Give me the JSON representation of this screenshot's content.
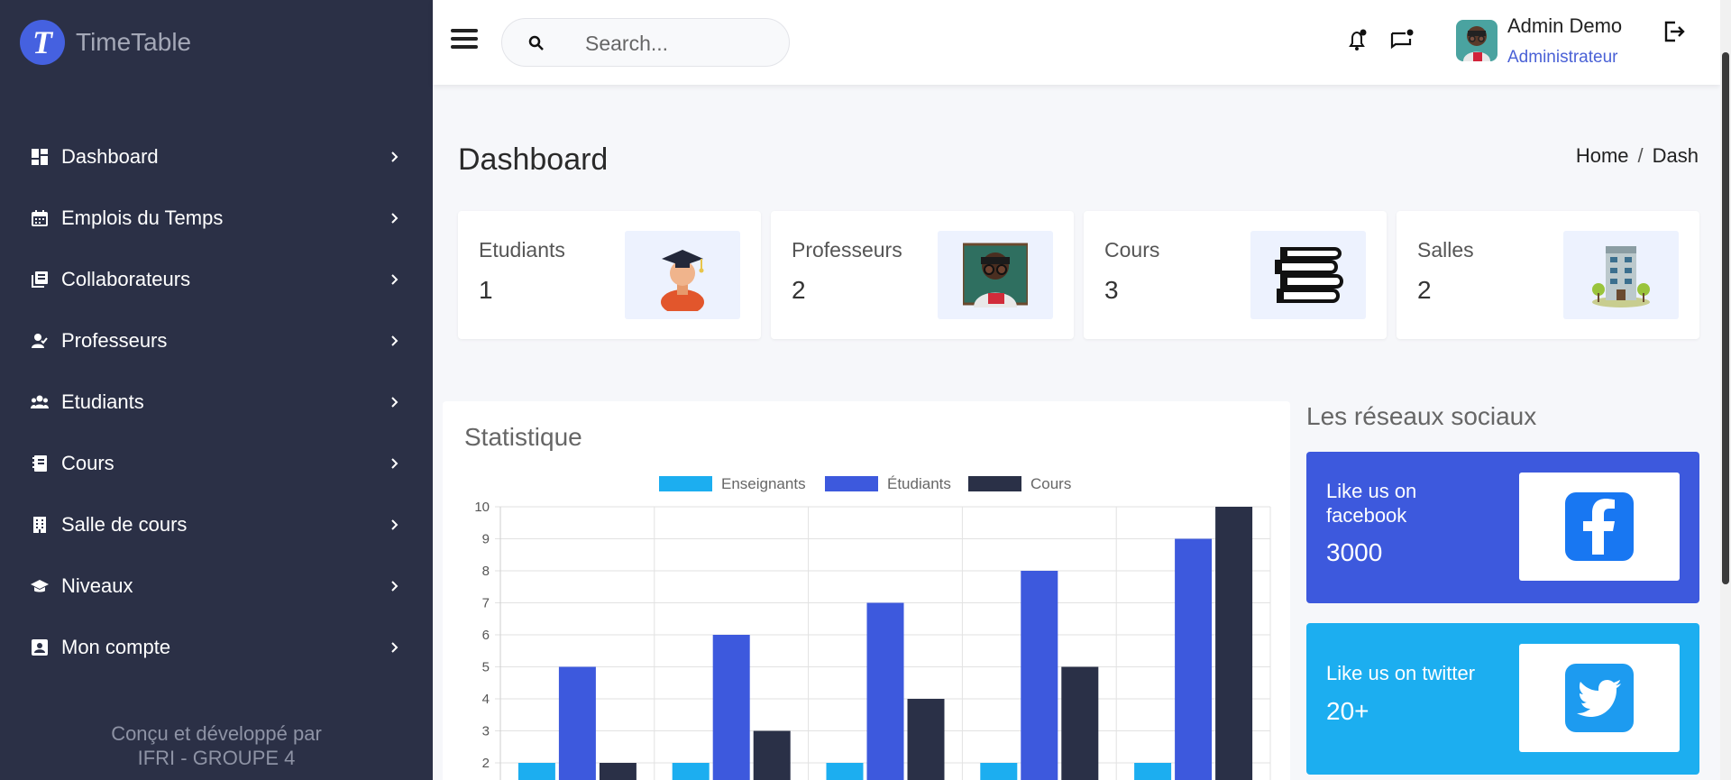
{
  "brand": {
    "logo_letter": "T",
    "name": "TimeTable"
  },
  "sidebar": {
    "items": [
      {
        "label": "Dashboard",
        "icon": "dashboard-icon"
      },
      {
        "label": "Emplois du Temps",
        "icon": "calendar-icon"
      },
      {
        "label": "Collaborateurs",
        "icon": "library-books-icon"
      },
      {
        "label": "Professeurs",
        "icon": "person-check-icon"
      },
      {
        "label": "Etudiants",
        "icon": "group-icon"
      },
      {
        "label": "Cours",
        "icon": "book-icon"
      },
      {
        "label": "Salle de cours",
        "icon": "building-icon"
      },
      {
        "label": "Niveaux",
        "icon": "graduation-cap-icon"
      },
      {
        "label": "Mon compte",
        "icon": "account-box-icon"
      }
    ],
    "footer_line1": "Conçu et développé par",
    "footer_line2": "IFRI - GROUPE 4"
  },
  "topbar": {
    "search_placeholder": "Search...",
    "user_name": "Admin Demo",
    "user_role": "Administrateur"
  },
  "page": {
    "title": "Dashboard",
    "breadcrumb": [
      "Home",
      "Dash"
    ]
  },
  "stats": [
    {
      "label": "Etudiants",
      "value": "1",
      "icon": "graduate-student-icon"
    },
    {
      "label": "Professeurs",
      "value": "2",
      "icon": "teacher-icon"
    },
    {
      "label": "Cours",
      "value": "3",
      "icon": "books-stack-icon"
    },
    {
      "label": "Salles",
      "value": "2",
      "icon": "building-icon"
    }
  ],
  "chart_card": {
    "title": "Statistique"
  },
  "social": {
    "title": "Les réseaux sociaux",
    "facebook": {
      "text": "Like us on facebook",
      "count": "3000",
      "color": "#3d59dd",
      "icon": "facebook-icon"
    },
    "twitter": {
      "text": "Like us on twitter",
      "count": "20+",
      "color": "#1caef0",
      "icon": "twitter-icon"
    }
  },
  "colors": {
    "sidebar_bg": "#2b3046",
    "accent": "#4561e0"
  },
  "chart_data": {
    "type": "bar",
    "categories": [
      "",
      "",
      "",
      "",
      ""
    ],
    "series": [
      {
        "name": "Enseignants",
        "color": "#1caef0",
        "values": [
          2,
          2,
          2,
          2,
          2
        ]
      },
      {
        "name": "Étudiants",
        "color": "#3d59dd",
        "values": [
          5,
          6,
          7,
          8,
          9
        ]
      },
      {
        "name": "Cours",
        "color": "#2a3047",
        "values": [
          2,
          3,
          4,
          5,
          10
        ]
      }
    ],
    "yticks": [
      "10",
      "9",
      "8",
      "7",
      "6",
      "5",
      "4",
      "3",
      "2"
    ],
    "ylim": [
      2,
      10
    ],
    "legend": "top",
    "grid": true
  }
}
